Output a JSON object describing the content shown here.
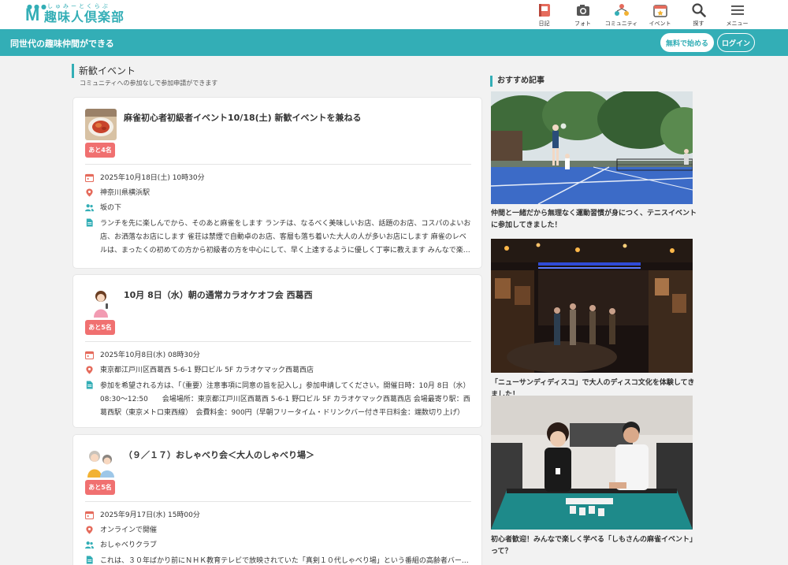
{
  "header": {
    "logo_ruby": "しゅみーとくらぶ",
    "logo_name": "趣味人倶楽部",
    "nav": [
      {
        "label": "日記",
        "icon": "diary-icon"
      },
      {
        "label": "フォト",
        "icon": "camera-icon"
      },
      {
        "label": "コミュニティ",
        "icon": "community-icon"
      },
      {
        "label": "イベント",
        "icon": "calendar-icon"
      },
      {
        "label": "探す",
        "icon": "search-icon"
      },
      {
        "label": "メニュー",
        "icon": "menu-icon"
      }
    ]
  },
  "topbar": {
    "tagline": "同世代の趣味仲間ができる",
    "free_button": "無料で始める",
    "login_button": "ログイン"
  },
  "events_section": {
    "title": "新歓イベント",
    "subtitle": "コミュニティへの参加なしで参加申請ができます",
    "events": [
      {
        "title": "麻雀初心者初級者イベント10/18(土) 新歓イベントを兼ねる",
        "badge": "あと4名",
        "datetime": "2025年10月18日(土) 10時30分",
        "location": "神奈川県横浜駅",
        "organizer": "坂の下",
        "description": "ランチを先に楽しんでから、そのあと麻雀をします ランチは、なるべく美味しいお店、話題のお店、コスパのよいお店、お洒落なお店にします 雀荘は禁煙で自動卓のお店、客層も落ち着いた大人の人が多いお店にします 麻雀のレベルは、まったくの初めての方から初級者の方を中心にして、早く上達するように優しく丁寧に教えます みんなで楽しく麻雀を覚えていこうと思います"
      },
      {
        "title": "10月 8日（水）朝の通常カラオケオフ会 西葛西",
        "badge": "あと5名",
        "datetime": "2025年10月8日(水) 08時30分",
        "location": "東京都江戸川区西葛西 5-6-1 野口ビル 5F カラオケマック西葛西店",
        "description": "参加を希望される方は、「（重要）注意事項に同意の旨を記入し」参加申請してください。開催日時：10月 8日（水）08:30～12:50　　会場場所：東京都江戸川区西葛西 5-6-1 野口ビル 5F カラオケマック西葛西店 会場最寄り駅：西葛西駅（東京メトロ東西線）　会費料金：900円（早朝フリータイム・ドリンクバー付き平日料金：端数切り上げ）"
      },
      {
        "title": "（９／１７）おしゃべり会＜大人のしゃべり場＞",
        "badge": "あと5名",
        "datetime": "2025年9月17日(水) 15時00分",
        "location": "オンラインで開催",
        "organizer": "おしゃべりクラブ",
        "description": "これは、３０年ばかり前にＮＨＫ教育テレビで放映されていた「真剣１０代しゃべり場」という番組の高齢者バージョンを再現したものです"
      }
    ]
  },
  "sidebar": {
    "title": "おすすめ記事",
    "articles": [
      {
        "caption": "仲間と一緒だから無理なく運動習慣が身につく、テニスイベントに参加してきました！"
      },
      {
        "caption": "「ニューサンディディスコ」で大人のディスコ文化を体験してきました！"
      },
      {
        "caption": "初心者歓迎！みんなで楽しく学べる「しもさんの麻雀イベント」って？"
      }
    ]
  },
  "colors": {
    "brand": "#33aeb6",
    "badge": "#f07070",
    "icon_accent": "#e56b5c"
  }
}
